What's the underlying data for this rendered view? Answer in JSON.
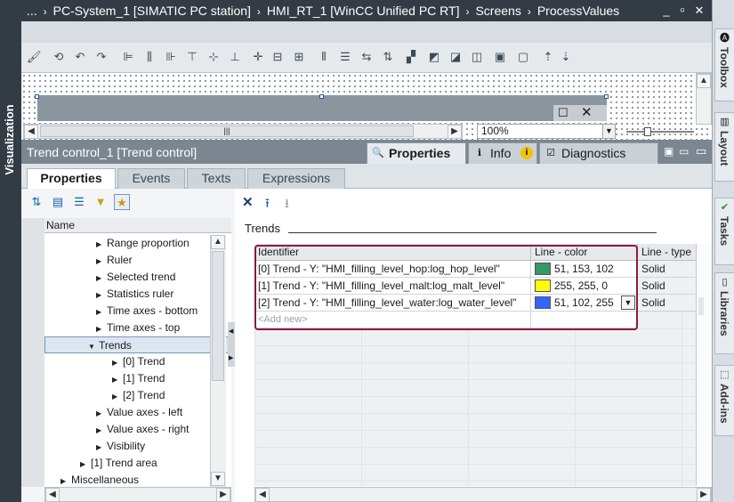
{
  "titlebar": {
    "segments": [
      "...",
      "PC-System_1 [SIMATIC PC station]",
      "HMI_RT_1 [WinCC Unified PC RT]",
      "Screens",
      "ProcessValues"
    ],
    "min": "_",
    "restore": "▫",
    "close": "✕"
  },
  "side_left": {
    "label": "Visualization"
  },
  "side_right": {
    "tabs": [
      "Toolbox",
      "Layout",
      "Tasks",
      "Libraries",
      "Add-ins"
    ]
  },
  "zoom": {
    "value": "100%"
  },
  "hscroll": {
    "thumb": "|||"
  },
  "panel": {
    "title": "Trend control_1 [Trend control]",
    "tabs": [
      "Properties",
      "Info",
      "Diagnostics"
    ]
  },
  "subtabs": [
    "Properties",
    "Events",
    "Texts",
    "Expressions"
  ],
  "tree": {
    "header": "Name",
    "rows": [
      {
        "label": "Range proportion",
        "expander": "▶"
      },
      {
        "label": "Ruler",
        "expander": "▶"
      },
      {
        "label": "Selected trend",
        "expander": "▶"
      },
      {
        "label": "Statistics ruler",
        "expander": "▶"
      },
      {
        "label": "Time axes - bottom",
        "expander": "▶"
      },
      {
        "label": "Time axes - top",
        "expander": "▶"
      },
      {
        "label": "Trends",
        "expander": "▼"
      },
      {
        "label": "[0] Trend",
        "expander": "▶"
      },
      {
        "label": "[1] Trend",
        "expander": "▶"
      },
      {
        "label": "[2] Trend",
        "expander": "▶"
      },
      {
        "label": "Value axes - left",
        "expander": "▶"
      },
      {
        "label": "Value axes - right",
        "expander": "▶"
      },
      {
        "label": "Visibility",
        "expander": "▶"
      },
      {
        "label": "[1] Trend area",
        "expander": "▶"
      },
      {
        "label": "Miscellaneous",
        "expander": "▶"
      }
    ]
  },
  "trends": {
    "section_label": "Trends",
    "columns": [
      "Identifier",
      "Line - color",
      "Line - type"
    ],
    "rows": [
      {
        "id": "[0] Trend - Y: \"HMI_filling_level_hop:log_hop_level\"",
        "color": "51, 153, 102",
        "swatch": "#339966",
        "type": "Solid"
      },
      {
        "id": "[1] Trend - Y: \"HMI_filling_level_malt:log_malt_level\"",
        "color": "255, 255, 0",
        "swatch": "#ffff00",
        "type": "Solid"
      },
      {
        "id": "[2] Trend - Y: \"HMI_filling_level_water:log_water_level\"",
        "color": "51, 102, 255",
        "swatch": "#3366ff",
        "type": "Solid"
      }
    ],
    "add_new": "<Add new>"
  },
  "colors": {
    "highlight": "#8c1a3c",
    "dark": "#333c44"
  }
}
